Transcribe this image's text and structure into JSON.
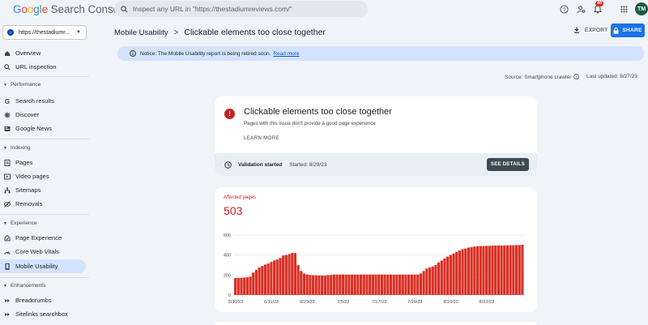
{
  "app": {
    "logo_google": [
      "G",
      "o",
      "o",
      "g",
      "l",
      "e"
    ],
    "logo_rest": "Search Console"
  },
  "search": {
    "placeholder": "Inspect any URL in \"https://thestadiumreviews.com/\""
  },
  "notifications": {
    "count": "46"
  },
  "user": {
    "initials": "TM"
  },
  "property": {
    "label": "https://thestadiumr..."
  },
  "sidebar": {
    "top_items": [
      {
        "label": "Overview",
        "icon": "home-icon"
      },
      {
        "label": "URL inspection",
        "icon": "search-icon"
      }
    ],
    "sections": [
      {
        "label": "Performance",
        "items": [
          {
            "label": "Search results",
            "icon": "google-g-icon"
          },
          {
            "label": "Discover",
            "icon": "asterisk-icon"
          },
          {
            "label": "Google News",
            "icon": "news-icon"
          }
        ]
      },
      {
        "label": "Indexing",
        "items": [
          {
            "label": "Pages",
            "icon": "pages-icon"
          },
          {
            "label": "Video pages",
            "icon": "video-pages-icon"
          },
          {
            "label": "Sitemaps",
            "icon": "sitemap-icon"
          },
          {
            "label": "Removals",
            "icon": "removals-icon"
          }
        ]
      },
      {
        "label": "Experience",
        "items": [
          {
            "label": "Page Experience",
            "icon": "page-experience-icon"
          },
          {
            "label": "Core Web Vitals",
            "icon": "speedometer-icon"
          },
          {
            "label": "Mobile Usability",
            "icon": "mobile-icon",
            "active": true
          }
        ]
      },
      {
        "label": "Enhancements",
        "items": [
          {
            "label": "Breadcrumbs",
            "icon": "breadcrumbs-icon"
          },
          {
            "label": "Sitelinks searchbox",
            "icon": "sitelinks-icon"
          }
        ]
      }
    ]
  },
  "header": {
    "breadcrumb_parent": "Mobile Usability",
    "breadcrumb_separator": ">",
    "title": "Clickable elements too close together",
    "export_label": "EXPORT",
    "share_label": "SHARE"
  },
  "notice": {
    "text": "Notice: The Mobile Usability report is being retired soon.",
    "link": "Read more"
  },
  "meta": {
    "source": "Source: Smartphone crawler",
    "last_updated": "Last updated: 8/27/23"
  },
  "issue": {
    "title": "Clickable elements too close together",
    "subtitle": "Pages with this issue don't provide a good page experience",
    "learn_more": "LEARN MORE",
    "validation_label": "Validation started",
    "validation_started": "Started: 8/29/23",
    "see_details": "SEE DETAILS"
  },
  "affected": {
    "label": "Affected pages",
    "value": "503"
  },
  "colors": {
    "bar": "#d93025",
    "accent": "#1a73e8",
    "error": "#c5221f",
    "active_nav": "#d3e3fd"
  },
  "chart_data": {
    "type": "bar",
    "ylabel": "",
    "ylim": [
      0,
      600
    ],
    "yticks": [
      "0",
      "200",
      "400",
      "600"
    ],
    "xticks": [
      "5/30/23",
      "6/11/23",
      "6/23/23",
      "7/5/23",
      "7/17/23",
      "7/29/23",
      "8/10/23",
      "8/22/23"
    ],
    "start_date": "5/30/23",
    "values": [
      170,
      170,
      172,
      175,
      178,
      185,
      225,
      250,
      275,
      290,
      305,
      315,
      330,
      345,
      355,
      370,
      395,
      400,
      410,
      420,
      420,
      300,
      240,
      215,
      205,
      200,
      198,
      197,
      196,
      195,
      195,
      198,
      200,
      205,
      205,
      205,
      205,
      205,
      205,
      205,
      205,
      205,
      205,
      205,
      205,
      205,
      205,
      205,
      205,
      205,
      205,
      205,
      205,
      205,
      205,
      205,
      205,
      205,
      205,
      205,
      205,
      205,
      215,
      240,
      265,
      275,
      285,
      300,
      325,
      345,
      365,
      385,
      400,
      415,
      430,
      445,
      458,
      465,
      475,
      480,
      485,
      488,
      490,
      490,
      492,
      492,
      495,
      495,
      495,
      495,
      496,
      497,
      498,
      498,
      500,
      500,
      503
    ]
  }
}
